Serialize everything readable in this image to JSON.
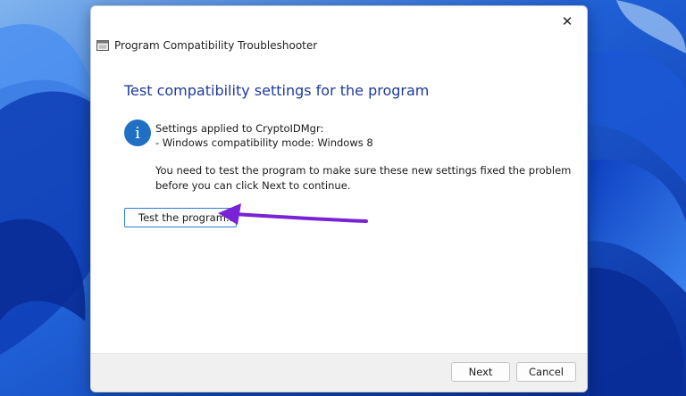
{
  "window": {
    "title": "Program Compatibility Troubleshooter",
    "close_label": "✕"
  },
  "content": {
    "heading": "Test compatibility settings for the program",
    "settings_applied": "Settings applied to CryptoIDMgr:",
    "compat_mode": "- Windows compatibility mode: Windows 8",
    "instructions": "You need to test the program to make sure these new settings fixed the problem before you can click Next to continue.",
    "info_glyph": "i",
    "test_button_label": "Test the program..."
  },
  "footer": {
    "next_label": "Next",
    "cancel_label": "Cancel"
  },
  "colors": {
    "heading": "#1e3a9a",
    "info_icon": "#1f6fc4",
    "annotation_arrow": "#7a22d6",
    "desktop": "#0b3fc0"
  },
  "icons": {
    "info": "info-icon",
    "close": "close-icon",
    "app": "troubleshooter-app-icon",
    "annotation": "annotation-arrow"
  }
}
